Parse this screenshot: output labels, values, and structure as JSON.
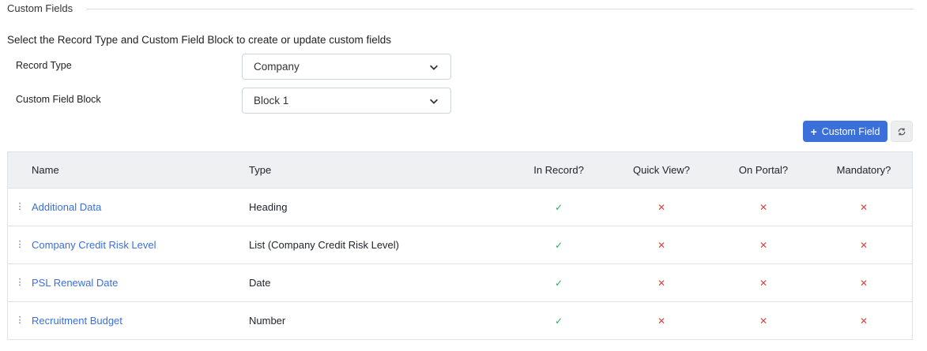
{
  "section": {
    "legend": "Custom Fields"
  },
  "intro": "Select the Record Type and Custom Field Block to create or update custom fields",
  "form": {
    "record_type_label": "Record Type",
    "record_type_value": "Company",
    "block_label": "Custom Field Block",
    "block_value": "Block 1"
  },
  "toolbar": {
    "add_label": "Custom Field",
    "add_icon": "plus-icon",
    "refresh_icon": "refresh-icon"
  },
  "table": {
    "headers": {
      "name": "Name",
      "type": "Type",
      "in_record": "In Record?",
      "quick_view": "Quick View?",
      "on_portal": "On Portal?",
      "mandatory": "Mandatory?"
    },
    "rows": [
      {
        "name": "Additional Data",
        "type": "Heading"
      },
      {
        "name": "Company Credit Risk Level",
        "type": "List (Company Credit Risk Level)"
      },
      {
        "name": "PSL Renewal Date",
        "type": "Date"
      },
      {
        "name": "Recruitment Budget",
        "type": "Number"
      }
    ],
    "flags": {
      "in_record": "yes",
      "quick_view": "no",
      "on_portal": "no",
      "mandatory": "no"
    }
  },
  "colors": {
    "accent": "#3b6fd9",
    "check": "#2eab64",
    "cross": "#e0443b"
  }
}
